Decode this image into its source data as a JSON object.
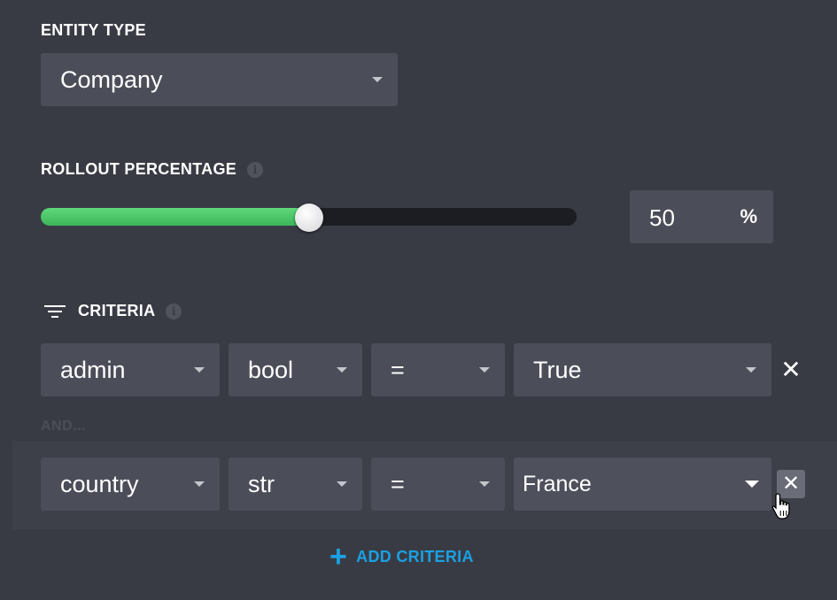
{
  "entity_type": {
    "label": "ENTITY TYPE",
    "value": "Company"
  },
  "rollout": {
    "label": "ROLLOUT PERCENTAGE",
    "info_icon": "i",
    "value": "50",
    "percent": 50,
    "unit": "%",
    "fill_color": "#4cc768"
  },
  "criteria": {
    "label": "CRITERIA",
    "info_icon": "i",
    "and_label": "AND...",
    "rows": [
      {
        "field": "admin",
        "type": "bool",
        "operator": "=",
        "value": "True",
        "remove": "✕"
      },
      {
        "field": "country",
        "type": "str",
        "operator": "=",
        "value": "France",
        "remove": "✕"
      }
    ],
    "add_label": "ADD CRITERIA",
    "add_icon": "+"
  },
  "colors": {
    "background": "#393b44",
    "control": "#4b4d58",
    "accent_blue": "#1aa1e3",
    "slider_green": "#4cc768"
  }
}
